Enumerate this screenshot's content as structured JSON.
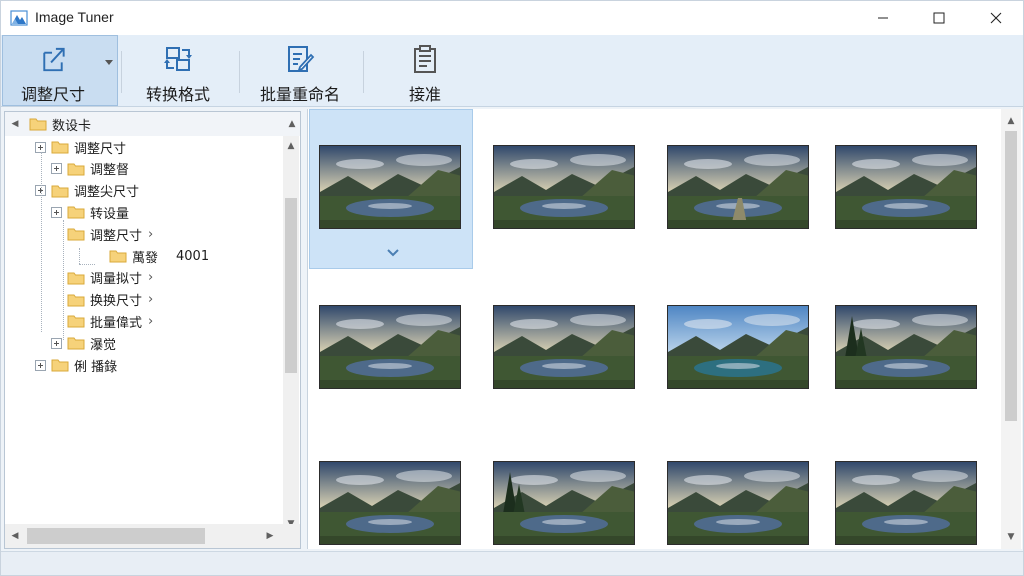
{
  "window": {
    "title": "Image Tuner",
    "min_icon": "minimize-icon",
    "max_icon": "maximize-icon",
    "close_icon": "close-icon"
  },
  "toolbar": {
    "items": [
      {
        "id": "resize",
        "label": "调整尺寸",
        "icon": "resize-icon",
        "selected": true,
        "has_dropdown": true
      },
      {
        "id": "convert",
        "label": "转换格式",
        "icon": "convert-icon"
      },
      {
        "id": "rename",
        "label": "批量重命名",
        "icon": "rename-icon"
      },
      {
        "id": "receive",
        "label": "接准",
        "icon": "clipboard-icon"
      }
    ]
  },
  "tree": {
    "root": "数设卡",
    "nodes": [
      {
        "label": "调整尺寸",
        "level": 0,
        "expander": true
      },
      {
        "label": "调整督",
        "level": 1,
        "expander": true
      },
      {
        "label": "调整尖尺寸",
        "level": 0,
        "expander": true
      },
      {
        "label": "转设量",
        "level": 1,
        "expander": true
      },
      {
        "label": "调整尺寸",
        "level": 1,
        "chevron": true
      },
      {
        "label": "萬發",
        "level": 2,
        "extra": "4001"
      },
      {
        "label": "调量拟寸",
        "level": 1,
        "chevron": true
      },
      {
        "label": "换换尺寸",
        "level": 1,
        "chevron": true
      },
      {
        "label": "批量偉式",
        "level": 1,
        "chevron": true
      },
      {
        "label": "瀑觉",
        "level": 1,
        "expander": true
      },
      {
        "label": "俐 播錄",
        "level": 0,
        "expander": true
      }
    ]
  },
  "gallery": {
    "selected_index": 0,
    "thumbnails": [
      {
        "name": "landscape-1",
        "variant": "lake-dusk"
      },
      {
        "name": "landscape-2",
        "variant": "lake-dusk"
      },
      {
        "name": "landscape-3",
        "variant": "path-dusk"
      },
      {
        "name": "landscape-4",
        "variant": "lake-dusk"
      },
      {
        "name": "landscape-5",
        "variant": "lake-dusk"
      },
      {
        "name": "landscape-6",
        "variant": "lake-dusk"
      },
      {
        "name": "landscape-7",
        "variant": "lake-blue"
      },
      {
        "name": "landscape-8",
        "variant": "forest-lake"
      },
      {
        "name": "landscape-9",
        "variant": "lake-dusk"
      },
      {
        "name": "landscape-10",
        "variant": "forest-lake"
      },
      {
        "name": "landscape-11",
        "variant": "lake-dusk"
      },
      {
        "name": "landscape-12",
        "variant": "lake-dusk"
      }
    ]
  },
  "colors": {
    "toolbar_bg": "#e4eef8",
    "selection": "#cde3f7",
    "folder": "#f6d27a",
    "folder_edge": "#d9a93a"
  }
}
